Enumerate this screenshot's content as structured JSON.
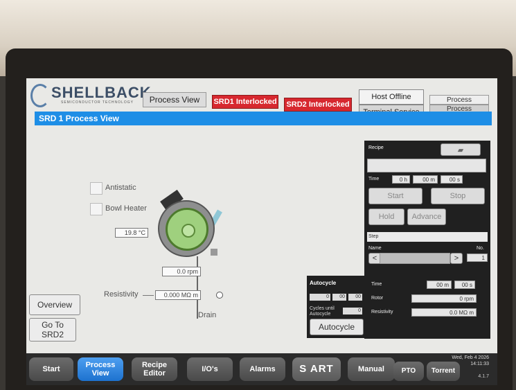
{
  "header": {
    "brand": "SHELLBACK",
    "brand_sub": "SEMICONDUCTOR TECHNOLOGY",
    "tab_process_view": "Process View",
    "srd1_status": "SRD1 Interlocked",
    "srd2_status": "SRD2 Interlocked",
    "host_status": "Host Offline",
    "terminal_service": "Terminal Service",
    "process_a": "Process",
    "process_b": "Process"
  },
  "title_bar": "SRD 1 Process View",
  "process": {
    "antistatic_label": "Antistatic",
    "bowl_heater_label": "Bowl Heater",
    "temp_value": "19.8",
    "temp_unit": "°C",
    "rpm_value": "0.0",
    "rpm_unit": "rpm",
    "resistivity_label": "Resistivity",
    "resistivity_value": "0.000",
    "resistivity_unit": "MΩ m",
    "drain_label": "Drain"
  },
  "left_nav": {
    "overview": "Overview",
    "goto_srd2": "Go To SRD2"
  },
  "autocycle": {
    "title": "Autocycle",
    "time_h": "0",
    "time_m": "00",
    "time_s": "00",
    "cycles_label": "Cycles until Autocycle",
    "cycles_value": "0",
    "button": "Autocycle"
  },
  "recipe": {
    "header": "Recipe",
    "time_label": "Time",
    "time_h": "0",
    "h_unit": "h",
    "time_m": "00",
    "m_unit": "m",
    "time_s": "00",
    "s_unit": "s",
    "start": "Start",
    "stop": "Stop",
    "hold": "Hold",
    "advance": "Advance"
  },
  "step": {
    "header": "Step",
    "name_label": "Name",
    "no_label": "No.",
    "no_value": "1",
    "time_label": "Time",
    "time_m": "00",
    "m_unit": "m",
    "time_s": "00",
    "s_unit": "s",
    "rotor_label": "Rotor",
    "rotor_value": "0 rpm",
    "resistivity_label": "Resistivity",
    "resistivity_value": "0.0 MΩ m"
  },
  "bottom_nav": {
    "start": "Start",
    "process_view": "Process View",
    "recipe_editor": "Recipe Editor",
    "ios": "I/O's",
    "alarms": "Alarms",
    "logo": "S ART",
    "manual": "Manual",
    "pto": "PTO",
    "torrent": "Torrent",
    "date": "Wed, Feb 4 2026",
    "time": "14:11:33",
    "version": "4.1.7"
  },
  "colors": {
    "accent_blue": "#1e8ee6",
    "interlock_red": "#d7282f",
    "selected_nav": "#1d72cf"
  }
}
